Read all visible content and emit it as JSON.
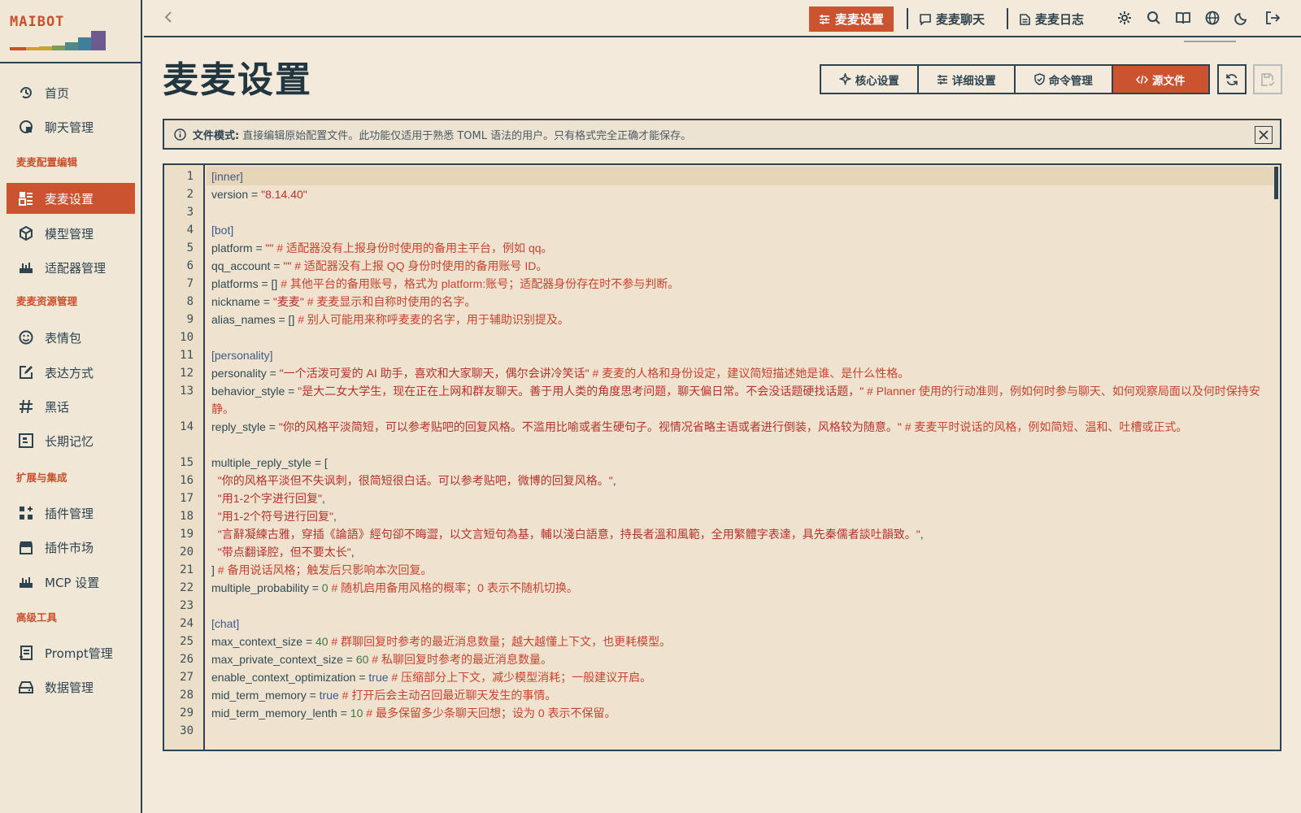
{
  "app": {
    "logo": "MAIBOT"
  },
  "sidebar": {
    "items": [
      {
        "label": "首页",
        "icon": "home-icon"
      },
      {
        "label": "聊天管理",
        "icon": "chat-manage-icon"
      },
      {
        "label": "麦麦设置",
        "icon": "settings-grid-icon"
      },
      {
        "label": "模型管理",
        "icon": "cube-icon"
      },
      {
        "label": "适配器管理",
        "icon": "router-icon"
      },
      {
        "label": "表情包",
        "icon": "smile-icon"
      },
      {
        "label": "表达方式",
        "icon": "edit-square-icon"
      },
      {
        "label": "黑话",
        "icon": "hash-icon"
      },
      {
        "label": "长期记忆",
        "icon": "memory-icon"
      },
      {
        "label": "插件管理",
        "icon": "plugin-grid-icon"
      },
      {
        "label": "插件市场",
        "icon": "store-icon"
      },
      {
        "label": "MCP 设置",
        "icon": "router-icon"
      },
      {
        "label": "Prompt管理",
        "icon": "prompt-icon"
      },
      {
        "label": "数据管理",
        "icon": "drive-icon"
      }
    ],
    "sections": [
      "麦麦配置编辑",
      "麦麦资源管理",
      "扩展与集成",
      "高级工具"
    ]
  },
  "topbar": {
    "tabs": [
      "麦麦设置",
      "麦麦聊天",
      "麦麦日志"
    ]
  },
  "page": {
    "title": "麦麦设置",
    "segments": [
      "核心设置",
      "详细设置",
      "命令管理",
      "源文件"
    ]
  },
  "notice": {
    "label": "文件模式:",
    "text": "直接编辑原始配置文件。此功能仅适用于熟悉 TOML 语法的用户。只有格式完全正确才能保存。"
  },
  "editor": {
    "lines": [
      {
        "n": "1",
        "segs": [
          [
            "sec",
            "[inner]"
          ]
        ]
      },
      {
        "n": "2",
        "segs": [
          [
            "key",
            "version = "
          ],
          [
            "str",
            "\"8.14.40\""
          ]
        ]
      },
      {
        "n": "3",
        "segs": []
      },
      {
        "n": "4",
        "segs": [
          [
            "sec",
            "[bot]"
          ]
        ]
      },
      {
        "n": "5",
        "segs": [
          [
            "key",
            "platform = "
          ],
          [
            "str",
            "\"\""
          ],
          [
            "com",
            " # 适配器没有上报身份时使用的备用主平台，例如 qq。"
          ]
        ]
      },
      {
        "n": "6",
        "segs": [
          [
            "key",
            "qq_account = "
          ],
          [
            "str",
            "\"\""
          ],
          [
            "com",
            " # 适配器没有上报 QQ 身份时使用的备用账号 ID。"
          ]
        ]
      },
      {
        "n": "7",
        "segs": [
          [
            "key",
            "platforms = [] "
          ],
          [
            "com",
            "# 其他平台的备用账号，格式为 platform:账号；适配器身份存在时不参与判断。"
          ]
        ]
      },
      {
        "n": "8",
        "segs": [
          [
            "key",
            "nickname = "
          ],
          [
            "str",
            "\"麦麦\""
          ],
          [
            "com",
            " # 麦麦显示和自称时使用的名字。"
          ]
        ]
      },
      {
        "n": "9",
        "segs": [
          [
            "key",
            "alias_names = [] "
          ],
          [
            "com",
            "# 别人可能用来称呼麦麦的名字，用于辅助识别提及。"
          ]
        ]
      },
      {
        "n": "10",
        "segs": []
      },
      {
        "n": "11",
        "segs": [
          [
            "sec",
            "[personality]"
          ]
        ]
      },
      {
        "n": "12",
        "segs": [
          [
            "key",
            "personality = "
          ],
          [
            "str",
            "\"一个活泼可爱的 AI 助手，喜欢和大家聊天，偶尔会讲冷笑话\""
          ],
          [
            "com",
            " # 麦麦的人格和身份设定，建议简短描述她是谁、是什么性格。"
          ]
        ]
      },
      {
        "n": "13",
        "segs": [
          [
            "key",
            "behavior_style = "
          ],
          [
            "str",
            "\"是大二女大学生，现在正在上网和群友聊天。善于用人类的角度思考问题，聊天偏日常。不会没话题硬找话题，\""
          ],
          [
            "com",
            " # Planner 使用的行动准则，例如何时参与聊天、如何观察局面以及何时保持安静。"
          ]
        ]
      },
      {
        "n": "14",
        "segs": [
          [
            "key",
            "reply_style = "
          ],
          [
            "str",
            "\"你的风格平淡简短，可以参考贴吧的回复风格。不滥用比喻或者生硬句子。视情况省略主语或者进行倒装，风格较为随意。\""
          ],
          [
            "com",
            " # 麦麦平时说话的风格，例如简短、温和、吐槽或正式。"
          ]
        ]
      },
      {
        "n": "15",
        "segs": [
          [
            "key",
            "multiple_reply_style = ["
          ]
        ]
      },
      {
        "n": "16",
        "segs": [
          [
            "key",
            "  "
          ],
          [
            "str",
            "\"你的风格平淡但不失讽刺，很简短很白话。可以参考贴吧，微博的回复风格。\""
          ],
          [
            "key",
            ","
          ]
        ]
      },
      {
        "n": "17",
        "segs": [
          [
            "key",
            "  "
          ],
          [
            "str",
            "\"用1-2个字进行回复\""
          ],
          [
            "key",
            ","
          ]
        ]
      },
      {
        "n": "18",
        "segs": [
          [
            "key",
            "  "
          ],
          [
            "str",
            "\"用1-2个符号进行回复\""
          ],
          [
            "key",
            ","
          ]
        ]
      },
      {
        "n": "19",
        "segs": [
          [
            "key",
            "  "
          ],
          [
            "str",
            "\"言辭凝練古雅，穿插《論語》經句卻不晦澀，以文言短句為基，輔以淺白語意，持長者溫和風範，全用繁體字表達，具先秦儒者談吐韻致。\""
          ],
          [
            "key",
            ","
          ]
        ]
      },
      {
        "n": "20",
        "segs": [
          [
            "key",
            "  "
          ],
          [
            "str",
            "\"带点翻译腔，但不要太长\""
          ],
          [
            "key",
            ","
          ]
        ]
      },
      {
        "n": "21",
        "segs": [
          [
            "key",
            "] "
          ],
          [
            "com",
            "# 备用说话风格；触发后只影响本次回复。"
          ]
        ]
      },
      {
        "n": "22",
        "segs": [
          [
            "key",
            "multiple_probability = "
          ],
          [
            "num",
            "0"
          ],
          [
            "com",
            " # 随机启用备用风格的概率；0 表示不随机切换。"
          ]
        ]
      },
      {
        "n": "23",
        "segs": []
      },
      {
        "n": "24",
        "segs": [
          [
            "sec",
            "[chat]"
          ]
        ]
      },
      {
        "n": "25",
        "segs": [
          [
            "key",
            "max_context_size = "
          ],
          [
            "num",
            "40"
          ],
          [
            "com",
            " # 群聊回复时参考的最近消息数量；越大越懂上下文，也更耗模型。"
          ]
        ]
      },
      {
        "n": "26",
        "segs": [
          [
            "key",
            "max_private_context_size = "
          ],
          [
            "num",
            "60"
          ],
          [
            "com",
            " # 私聊回复时参考的最近消息数量。"
          ]
        ]
      },
      {
        "n": "27",
        "segs": [
          [
            "key",
            "enable_context_optimization = "
          ],
          [
            "bool",
            "true"
          ],
          [
            "com",
            " # 压缩部分上下文，减少模型消耗；一般建议开启。"
          ]
        ]
      },
      {
        "n": "28",
        "segs": [
          [
            "key",
            "mid_term_memory = "
          ],
          [
            "bool",
            "true"
          ],
          [
            "com",
            " # 打开后会主动召回最近聊天发生的事情。"
          ]
        ]
      },
      {
        "n": "29",
        "segs": [
          [
            "key",
            "mid_term_memory_lenth = "
          ],
          [
            "num",
            "10"
          ],
          [
            "com",
            " # 最多保留多少条聊天回想；设为 0 表示不保留。"
          ]
        ]
      },
      {
        "n": "30",
        "segs": []
      }
    ]
  }
}
